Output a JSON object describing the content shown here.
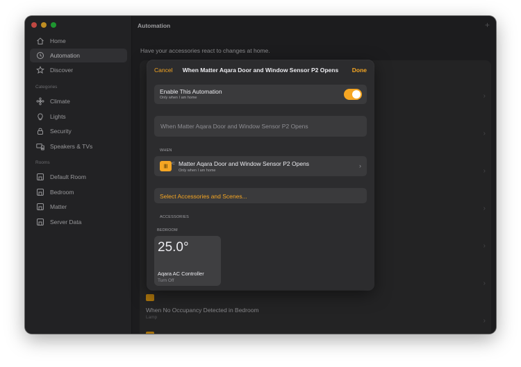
{
  "colors": {
    "accent": "#f5a623",
    "traffic_close": "#ff5f57",
    "traffic_min": "#febc2e",
    "traffic_max": "#28c840"
  },
  "sidebar": {
    "items": [
      {
        "label": "Home",
        "icon": "house-icon"
      },
      {
        "label": "Automation",
        "icon": "clock-icon",
        "active": true
      },
      {
        "label": "Discover",
        "icon": "star-icon"
      }
    ],
    "categories_label": "Categories",
    "categories": [
      {
        "label": "Climate",
        "icon": "fan-icon"
      },
      {
        "label": "Lights",
        "icon": "lightbulb-icon"
      },
      {
        "label": "Security",
        "icon": "lock-icon"
      },
      {
        "label": "Speakers & TVs",
        "icon": "speaker-tv-icon"
      }
    ],
    "rooms_label": "Rooms",
    "rooms": [
      {
        "label": "Default Room",
        "icon": "room-icon"
      },
      {
        "label": "Bedroom",
        "icon": "room-icon"
      },
      {
        "label": "Matter",
        "icon": "room-icon"
      },
      {
        "label": "Server Data",
        "icon": "room-icon"
      }
    ]
  },
  "main": {
    "title": "Automation",
    "subtitle": "Have your accessories react to changes at home.",
    "bottom_row": {
      "title": "When No Occupancy Detected in Bedroom",
      "subtitle": "Lamp"
    }
  },
  "modal": {
    "cancel_label": "Cancel",
    "done_label": "Done",
    "title": "When Matter Aqara Door and Window Sensor P2 Opens",
    "enable": {
      "title": "Enable This Automation",
      "subtitle": "Only when I am home",
      "on": true
    },
    "name_field": "When Matter Aqara Door and Window Sensor P2 Opens",
    "when_label": "WHEN",
    "trigger": {
      "title": "Matter Aqara Door and Window Sensor P2 Opens",
      "subtitle": "Only when I am home",
      "icon": "contact-sensor-icon"
    },
    "select_label": "Select Accessories and Scenes...",
    "accessories_label": "ACCESSORIES",
    "room_label": "BEDROOM",
    "tile": {
      "temp": "25.0°",
      "name": "Aqara AC Controller",
      "state": "Turn Off"
    }
  }
}
